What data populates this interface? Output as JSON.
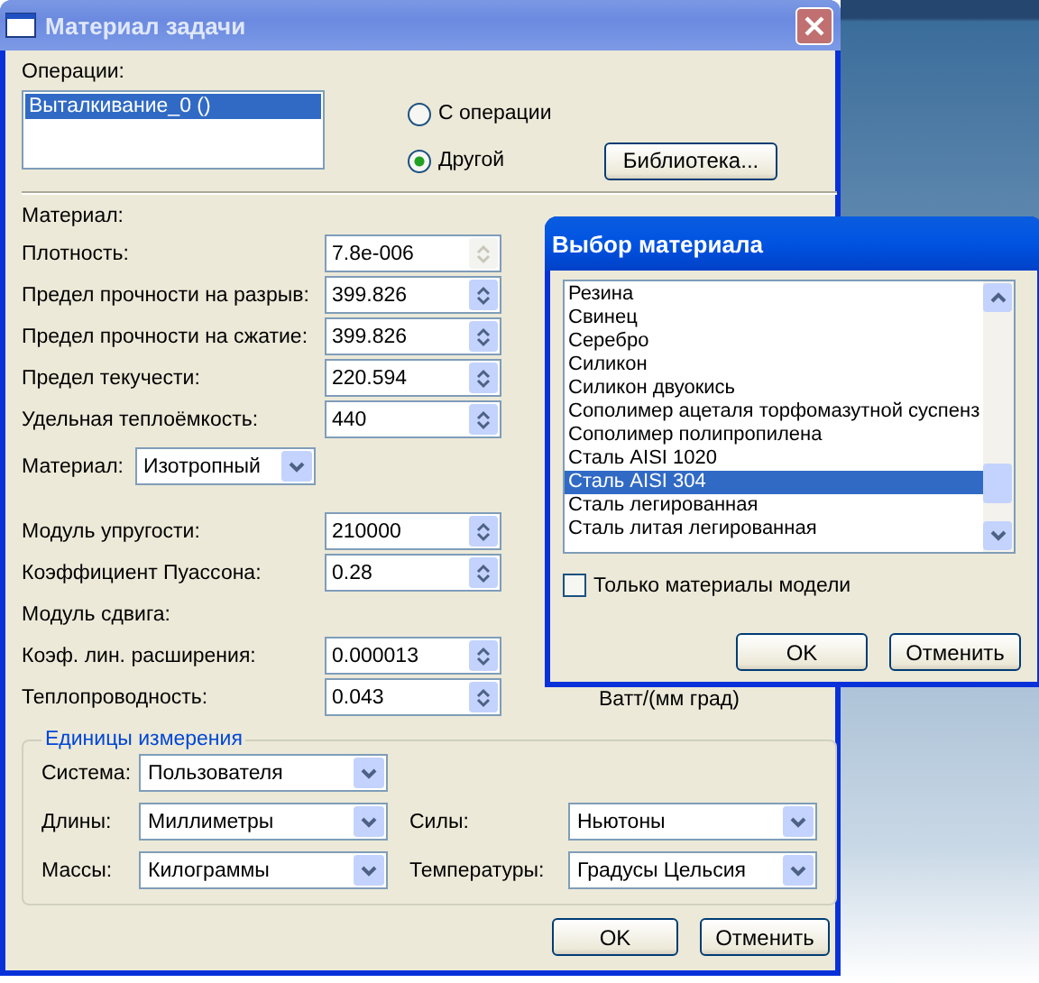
{
  "window": {
    "title": "Материал задачи"
  },
  "operations": {
    "label": "Операции:",
    "items": [
      {
        "label": "Выталкивание_0 ()",
        "selected": true
      }
    ]
  },
  "source_options": [
    {
      "label": "С операции",
      "selected": false
    },
    {
      "label": "Другой",
      "selected": true
    }
  ],
  "library_button": "Библиотека...",
  "material_label": "Материал:",
  "properties": [
    {
      "label": "Плотность:",
      "value": "7.8e-006",
      "disabled": true
    },
    {
      "label": "Предел прочности на разрыв:",
      "value": "399.826",
      "disabled": false
    },
    {
      "label": "Предел прочности на сжатие:",
      "value": "399.826",
      "disabled": false
    },
    {
      "label": "Предел текучести:",
      "value": "220.594",
      "disabled": false
    },
    {
      "label": "Удельная теплоёмкость:",
      "value": "440",
      "disabled": false
    }
  ],
  "material_type": {
    "label": "Материал:",
    "value": "Изотропный"
  },
  "mechanical": [
    {
      "kind": "spin",
      "label": "Модуль упругости:",
      "value": "210000"
    },
    {
      "kind": "spin",
      "label": "Коэффициент Пуассона:",
      "value": "0.28"
    },
    {
      "kind": "text",
      "label": "Модуль сдвига:"
    },
    {
      "kind": "spin",
      "label": "Коэф. лин. расширения:",
      "value": "0.000013"
    },
    {
      "kind": "spin",
      "label": "Теплопроводность:",
      "value": "0.043"
    }
  ],
  "units_note": "Ватт/(мм град)",
  "units": {
    "title": "Единицы измерения",
    "system": {
      "label": "Система:",
      "value": "Пользователя"
    },
    "fields": [
      {
        "label": "Длины:",
        "value": "Миллиметры"
      },
      {
        "label": "Силы:",
        "value": "Ньютоны"
      },
      {
        "label": "Массы:",
        "value": "Килограммы"
      },
      {
        "label": "Температуры:",
        "value": "Градусы Цельсия"
      }
    ]
  },
  "buttons": [
    "OK",
    "Отменить"
  ],
  "popup": {
    "title": "Выбор материала",
    "items": [
      {
        "label": "Резина",
        "selected": false
      },
      {
        "label": "Свинец",
        "selected": false
      },
      {
        "label": "Серебро",
        "selected": false
      },
      {
        "label": "Силикон",
        "selected": false
      },
      {
        "label": "Силикон двуокись",
        "selected": false
      },
      {
        "label": "Сополимер ацеталя торфомазутной суспенз",
        "selected": false
      },
      {
        "label": "Сополимер полипропилена",
        "selected": false
      },
      {
        "label": "Сталь AISI 1020",
        "selected": false
      },
      {
        "label": "Сталь AISI 304",
        "selected": true
      },
      {
        "label": "Сталь легированная",
        "selected": false
      },
      {
        "label": "Сталь литая легированная",
        "selected": false
      }
    ],
    "only_model": {
      "label": "Только материалы модели",
      "checked": false
    },
    "buttons": [
      "OK",
      "Отменить"
    ]
  }
}
